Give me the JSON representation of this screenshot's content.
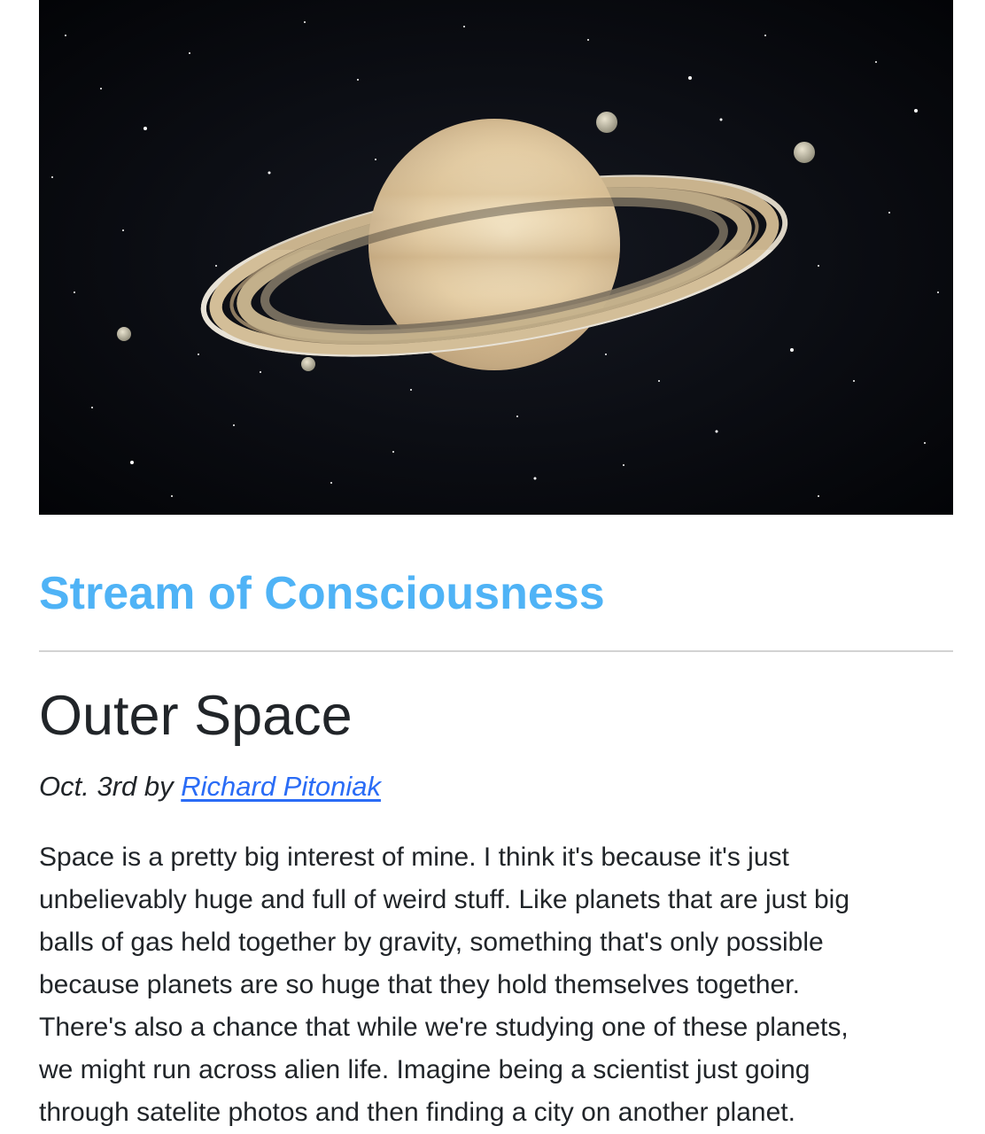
{
  "hero": {
    "image": "saturn-in-space",
    "colors": {
      "background": "#05060a",
      "planet": "#e7d2aa",
      "rings": "#cdbb96"
    }
  },
  "blog": {
    "title": "Stream of Consciousness",
    "title_color": "#4fb3f6"
  },
  "post": {
    "title": "Outer Space",
    "date_prefix": "Oct. 3rd by ",
    "author": "Richard Pitoniak",
    "link_color": "#2a6cf6",
    "body_lines": [
      "Space is a pretty big interest of mine. I think it's because it's just",
      "unbelievably huge and full of weird stuff. Like planets that are just big",
      "balls of gas held together by gravity, something that's only possible",
      "because planets are so huge that they hold themselves together.",
      "There's also a chance that while we're studying one of these planets,",
      "we might run across alien life. Imagine being a scientist just going",
      "through satelite photos and then finding a city on another planet."
    ]
  }
}
